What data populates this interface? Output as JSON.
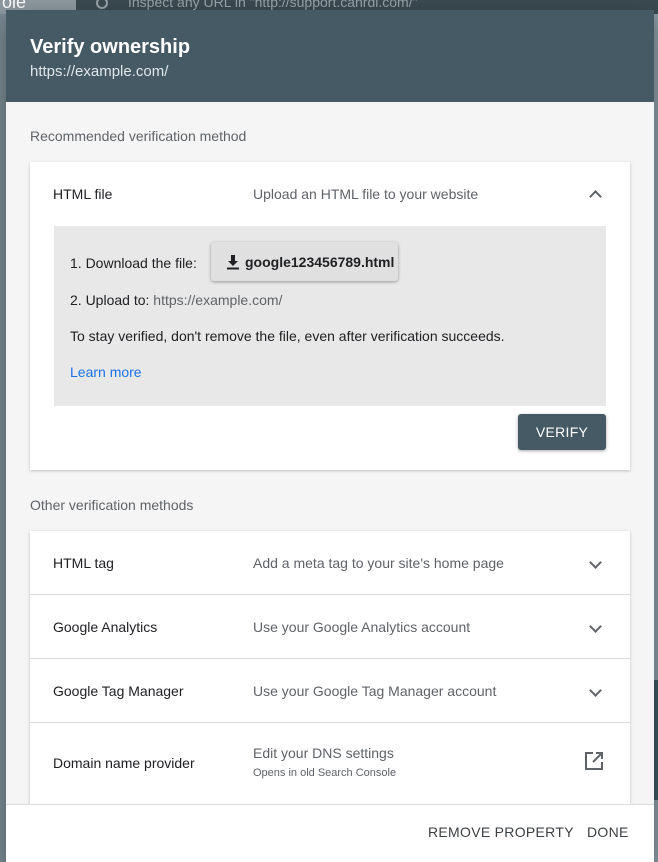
{
  "background": {
    "logo_text": "ole",
    "search_placeholder": "Inspect any URL in \"http://support.cahrdl.com/\""
  },
  "dialog": {
    "title": "Verify ownership",
    "subtitle": "https://example.com/"
  },
  "recommended": {
    "label": "Recommended verification method",
    "method": {
      "name": "HTML file",
      "description": "Upload an HTML file to your website",
      "step1_label": "1. Download the file:",
      "download_file": "google123456789.html",
      "step2_label": "2. Upload to:",
      "upload_url": "https://example.com/",
      "note": "To stay verified, don't remove the file, even after verification succeeds.",
      "learn_more": "Learn more",
      "verify_label": "VERIFY"
    }
  },
  "other": {
    "label": "Other verification methods",
    "methods": [
      {
        "name": "HTML tag",
        "description": "Add a meta tag to your site's home page"
      },
      {
        "name": "Google Analytics",
        "description": "Use your Google Analytics account"
      },
      {
        "name": "Google Tag Manager",
        "description": "Use your Google Tag Manager account"
      },
      {
        "name": "Domain name provider",
        "description": "Edit your DNS settings",
        "note": "Opens in old Search Console"
      }
    ]
  },
  "footer": {
    "remove_label": "REMOVE PROPERTY",
    "done_label": "DONE"
  },
  "colors": {
    "header": "#455a64",
    "link": "#1a73e8",
    "verify_button": "#455a64"
  }
}
